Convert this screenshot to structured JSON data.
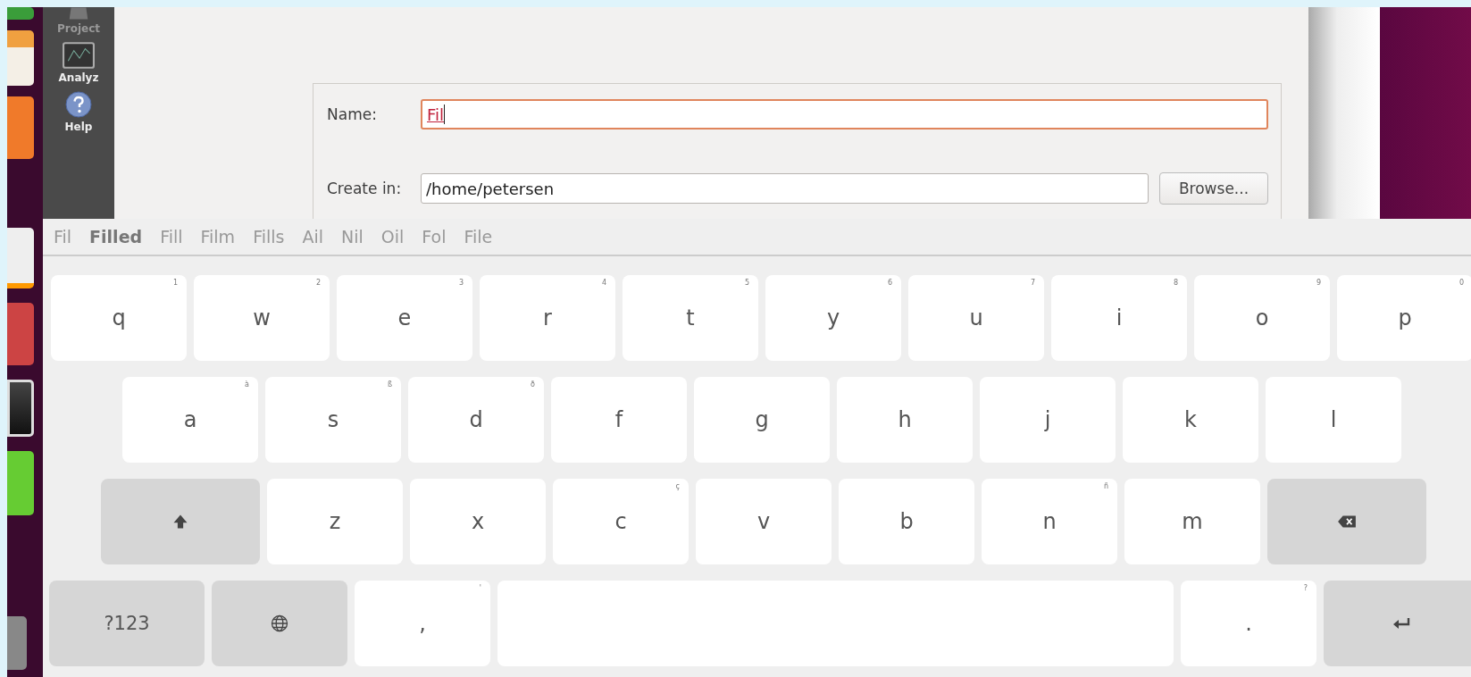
{
  "sidebar": {
    "items": [
      {
        "label": "Project"
      },
      {
        "label": "Analyz"
      },
      {
        "label": "Help"
      }
    ]
  },
  "dialog": {
    "name_label": "Name:",
    "name_value": "Fil",
    "name_focused": true,
    "create_label": "Create in:",
    "create_value": "/home/petersen",
    "browse_button": "Browse..."
  },
  "suggestions": [
    {
      "label": "Fil",
      "selected": false
    },
    {
      "label": "Filled",
      "selected": true
    },
    {
      "label": "Fill",
      "selected": false
    },
    {
      "label": "Film",
      "selected": false
    },
    {
      "label": "Fills",
      "selected": false
    },
    {
      "label": "Ail",
      "selected": false
    },
    {
      "label": "Nil",
      "selected": false
    },
    {
      "label": "Oil",
      "selected": false
    },
    {
      "label": "Fol",
      "selected": false
    },
    {
      "label": "File",
      "selected": false
    }
  ],
  "keyboard": {
    "rows": [
      [
        {
          "kind": "letter",
          "label": "q",
          "hint": "1"
        },
        {
          "kind": "letter",
          "label": "w",
          "hint": "2"
        },
        {
          "kind": "letter",
          "label": "e",
          "hint": "3"
        },
        {
          "kind": "letter",
          "label": "r",
          "hint": "4"
        },
        {
          "kind": "letter",
          "label": "t",
          "hint": "5"
        },
        {
          "kind": "letter",
          "label": "y",
          "hint": "6"
        },
        {
          "kind": "letter",
          "label": "u",
          "hint": "7"
        },
        {
          "kind": "letter",
          "label": "i",
          "hint": "8"
        },
        {
          "kind": "letter",
          "label": "o",
          "hint": "9"
        },
        {
          "kind": "letter",
          "label": "p",
          "hint": "0"
        }
      ],
      [
        {
          "kind": "letter",
          "label": "a",
          "hint": "à"
        },
        {
          "kind": "letter",
          "label": "s",
          "hint": "ß"
        },
        {
          "kind": "letter",
          "label": "d",
          "hint": "ð"
        },
        {
          "kind": "letter",
          "label": "f"
        },
        {
          "kind": "letter",
          "label": "g"
        },
        {
          "kind": "letter",
          "label": "h"
        },
        {
          "kind": "letter",
          "label": "j"
        },
        {
          "kind": "letter",
          "label": "k"
        },
        {
          "kind": "letter",
          "label": "l"
        }
      ],
      [
        {
          "kind": "shift"
        },
        {
          "kind": "letter",
          "label": "z"
        },
        {
          "kind": "letter",
          "label": "x"
        },
        {
          "kind": "letter",
          "label": "c",
          "hint": "ç"
        },
        {
          "kind": "letter",
          "label": "v"
        },
        {
          "kind": "letter",
          "label": "b"
        },
        {
          "kind": "letter",
          "label": "n",
          "hint": "ñ"
        },
        {
          "kind": "letter",
          "label": "m"
        },
        {
          "kind": "backspace"
        }
      ],
      [
        {
          "kind": "symbols",
          "label": "?123"
        },
        {
          "kind": "globe"
        },
        {
          "kind": "letter",
          "label": ",",
          "hint": "'"
        },
        {
          "kind": "space"
        },
        {
          "kind": "letter",
          "label": ".",
          "hint": "?"
        },
        {
          "kind": "enter"
        }
      ]
    ]
  }
}
